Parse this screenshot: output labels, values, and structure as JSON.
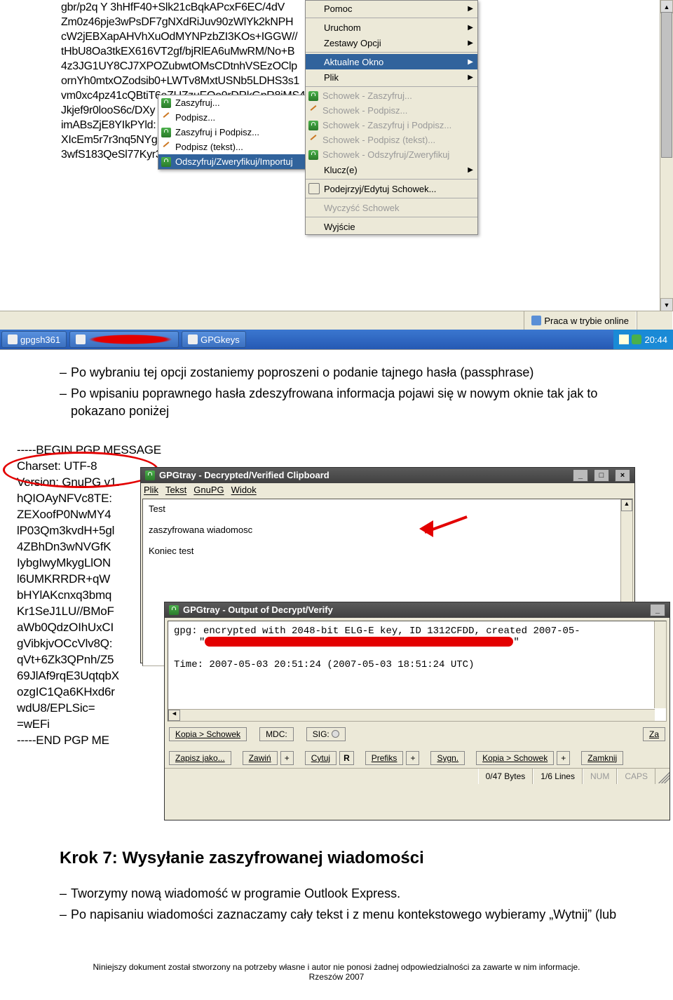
{
  "screenshot1": {
    "pgp_lines": [
      "gbr/p2q Y 3hHfF40+Slk21cBqkAPcxF6EC/4dV",
      "Zm0z46pje3wPsDF7gNXdRiJuv90zWlYk2kNPH",
      "cW2jEBXapAHVhXuOdMYNPzbZI3KOs+IGGW//",
      "tHbU8Oa3tkEX616VT2gf/bjRlEA6uMwRM/No+B",
      "4z3JG1UY8CJ7XPOZubwtOMsCDtnhVSEzOClp",
      "ornYh0mtxOZodsib0+LWTv8MxtUSNb5LDHS3s1",
      "vm0xc4pz41cQBtiT6eZUZzuEOo9rDRkGpR8iMS4",
      "Jkjef9r0looS6c/DXy",
      "imABsZjE8YIkPYld:",
      "XIcEm5r7r3nq5NYg2",
      "3wfS183QeSl77Kyr3"
    ],
    "submenu1": {
      "zaszyfruj": "Zaszyfruj...",
      "podpisz": "Podpisz...",
      "zaszyfruj_podpisz": "Zaszyfruj i Podpisz...",
      "podpisz_tekst": "Podpisz (tekst)...",
      "odszyfruj": "Odszyfruj/Zweryfikuj/Importuj"
    },
    "main_menu": {
      "pomoc": "Pomoc",
      "uruchom": "Uruchom",
      "zestawy": "Zestawy Opcji",
      "aktualne_okno": "Aktualne Okno",
      "plik": "Plik",
      "schowek_zaszyfruj": "Schowek - Zaszyfruj...",
      "schowek_podpisz": "Schowek - Podpisz...",
      "schowek_zaszyfruj_podpisz": "Schowek - Zaszyfruj i Podpisz...",
      "schowek_podpisz_tekst": "Schowek - Podpisz (tekst)...",
      "schowek_odszyfruj": "Schowek - Odszyfruj/Zweryfikuj",
      "klucze": "Klucz(e)",
      "podejrzyj": "Podejrzyj/Edytuj Schowek...",
      "wyczysc": "Wyczyść Schowek",
      "wyjscie": "Wyjście"
    },
    "status_text": "Praca w trybie online",
    "taskbar": {
      "gpgsh": "gpgsh361",
      "gpgkeys": "GPGkeys",
      "clock": "20:44"
    }
  },
  "doc_para1": {
    "li1": "Po wybraniu tej opcji zostaniemy poproszeni o podanie tajnego hasła (passphrase)",
    "li2": "Po wpisaniu poprawnego hasła zdeszyfrowana informacja pojawi się w nowym oknie tak jak to pokazano poniżej"
  },
  "screenshot2": {
    "bg_lines": [
      "-----BEGIN PGP MESSAGE",
      "Charset: UTF-8",
      "Version: GnuPG v1.",
      "",
      "hQIOAyNFVc8TE:",
      "ZEXoofP0NwMY4",
      "lP03Qm3kvdH+5gl",
      "4ZBhDn3wNVGfK",
      "IybgIwyMkygLlON",
      "l6UMKRRDR+qW",
      "bHYlAKcnxq3bmq",
      "Kr1SeJ1LU//BMoF",
      "aWb0QdzOIhUxCI",
      "gVibkjvOCcVlv8Q:",
      "qVt+6Zk3QPnh/Z5",
      "69JlAf9rqE3UqtqbX",
      "ozgIC1Qa6KHxd6r",
      "wdU8/EPLSic=",
      "=wEFi",
      "-----END PGP ME"
    ],
    "clip": {
      "title": "GPGtray - Decrypted/Verified Clipboard",
      "menu": {
        "plik": "Plik",
        "tekst": "Tekst",
        "gnupg": "GnuPG",
        "widok": "Widok"
      },
      "body": {
        "l1": "Test",
        "l2": "zaszyfrowana wiadomosc",
        "l3": "Koniec test"
      }
    },
    "out": {
      "title": "GPGtray - Output of Decrypt/Verify",
      "gpg_line": "gpg: encrypted with 2048-bit ELG-E key, ID 1312CFDD, created 2007-05-",
      "quote": "\"",
      "time_line": "Time: 2007-05-03 20:51:24 (2007-05-03 18:51:24 UTC)"
    },
    "buttons_row1": {
      "kopia": "Kopia > Schowek",
      "mdc": "MDC:",
      "sig": "SIG:",
      "za": "Za"
    },
    "buttons_row2": {
      "zapisz": "Zapisz jako...",
      "zawin": "Zawiń",
      "plus": "+",
      "cytuj": "Cytuj",
      "r": "R",
      "prefiks": "Prefiks",
      "sygn": "Sygn.",
      "kopia": "Kopia > Schowek",
      "zamknij": "Zamknij"
    },
    "status": {
      "bytes": "0/47 Bytes",
      "lines": "1/6 Lines",
      "num": "NUM",
      "caps": "CAPS"
    }
  },
  "step7_heading": "Krok 7: Wysyłanie zaszyfrowanej wiadomości",
  "doc_para2": {
    "li1": "Tworzymy nową wiadomość w programie Outlook Express.",
    "li2": "Po napisaniu wiadomości zaznaczamy cały tekst i z menu kontekstowego wybieramy „Wytnij” (lub"
  },
  "footer": {
    "l1": "Niniejszy dokument został stworzony na potrzeby własne i autor nie ponosi żadnej odpowiedzialności za zawarte w nim informacje.",
    "l2": "Rzeszów 2007"
  }
}
